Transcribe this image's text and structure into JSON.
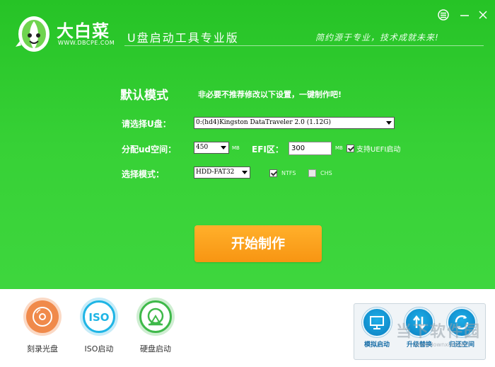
{
  "header": {
    "brand_name": "大白菜",
    "brand_url": "WWW.DBCPE.COM",
    "app_title": "U盘启动工具专业版",
    "slogan": "简约源于专业，技术成就未来!"
  },
  "main": {
    "section_title": "默认模式",
    "section_tip": "非必要不推荐修改以下设置，一键制作吧!",
    "usb_label": "请选择U盘：",
    "usb_value": "0:(hd4)Kingston DataTraveler 2.0 (1.12G)",
    "ud_label": "分配ud空间：",
    "ud_value": "450",
    "ud_unit": "MB",
    "efi_label": "EFI区：",
    "efi_value": "300",
    "efi_unit": "MB",
    "uefi_label": "支持UEFI启动",
    "uefi_checked": true,
    "mode_label": "选择模式：",
    "mode_value": "HDD-FAT32",
    "ntfs_label": "NTFS",
    "ntfs_checked": true,
    "chs_label": "CHS",
    "chs_checked": false,
    "start_button": "开始制作"
  },
  "bottom": {
    "tools": [
      {
        "label": "刻录光盘",
        "icon": "disc-icon"
      },
      {
        "label": "ISO启动",
        "icon": "iso-icon"
      },
      {
        "label": "硬盘启动",
        "icon": "hard-disk-icon"
      }
    ],
    "right_tools": [
      {
        "label": "模拟启动",
        "icon": "monitor-icon"
      },
      {
        "label": "升级替换",
        "icon": "upgrade-icon"
      },
      {
        "label": "归还空间",
        "icon": "refresh-icon"
      }
    ]
  },
  "watermark": {
    "text": "当下软件园",
    "url": "www.downxia.com"
  },
  "colors": {
    "background_green": "#2cc72c",
    "start_button": "#f89512",
    "burn_disc": "#f08a4b",
    "iso": "#1fb5e5",
    "hdd": "#3fb94a",
    "right_tool": "#0b7fc0"
  }
}
